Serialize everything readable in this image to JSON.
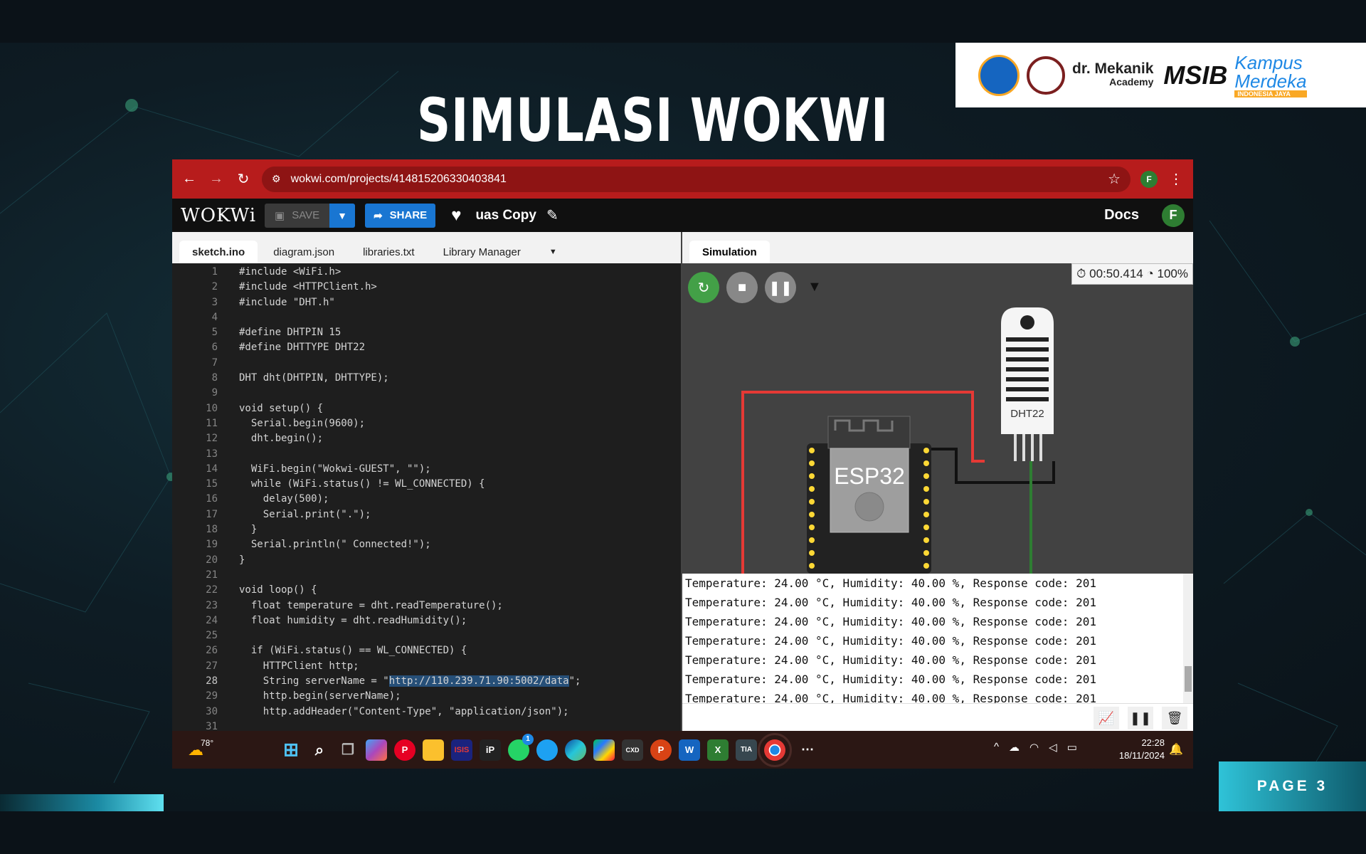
{
  "slide": {
    "title": "SIMULASI WOKWI",
    "page_label": "PAGE 3",
    "logos": {
      "org1": "dr. Mekanik",
      "org1_sub": "Academy",
      "org2": "MSIB",
      "org3": "Kampus",
      "org3b": "Merdeka",
      "org3_sub": "INDONESIA JAYA"
    }
  },
  "browser": {
    "url": "wokwi.com/projects/414815206330403841",
    "profile": "F"
  },
  "wokwi": {
    "logo": "WOKWi",
    "save_label": "SAVE",
    "share_label": "SHARE",
    "project_name": "uas Copy",
    "docs_label": "Docs",
    "user_initial": "F"
  },
  "editor": {
    "tabs": [
      "sketch.ino",
      "diagram.json",
      "libraries.txt",
      "Library Manager"
    ],
    "active_tab": "sketch.ino",
    "current_line": 28,
    "lines": [
      "#include <WiFi.h>",
      "#include <HTTPClient.h>",
      "#include \"DHT.h\"",
      "",
      "#define DHTPIN 15",
      "#define DHTTYPE DHT22",
      "",
      "DHT dht(DHTPIN, DHTTYPE);",
      "",
      "void setup() {",
      "  Serial.begin(9600);",
      "  dht.begin();",
      "",
      "  WiFi.begin(\"Wokwi-GUEST\", \"\");",
      "  while (WiFi.status() != WL_CONNECTED) {",
      "    delay(500);",
      "    Serial.print(\".\");",
      "  }",
      "  Serial.println(\" Connected!\");",
      "}",
      "",
      "void loop() {",
      "  float temperature = dht.readTemperature();",
      "  float humidity = dht.readHumidity();",
      "",
      "  if (WiFi.status() == WL_CONNECTED) {",
      "    HTTPClient http;",
      "    String serverName = \"http://110.239.71.90:5002/data\";",
      "    http.begin(serverName);",
      "    http.addHeader(\"Content-Type\", \"application/json\");",
      ""
    ],
    "selected_text": "http://110.239.71.90:5002/data"
  },
  "simulation": {
    "tab_label": "Simulation",
    "timer": "00:50.414",
    "speed": "100%",
    "board_label": "ESP32",
    "sensor_label": "DHT22",
    "serial_lines": [
      "Temperature: 24.00 °C, Humidity: 40.00 %, Response code: 201",
      "Temperature: 24.00 °C, Humidity: 40.00 %, Response code: 201",
      "Temperature: 24.00 °C, Humidity: 40.00 %, Response code: 201",
      "Temperature: 24.00 °C, Humidity: 40.00 %, Response code: 201",
      "Temperature: 24.00 °C, Humidity: 40.00 %, Response code: 201",
      "Temperature: 24.00 °C, Humidity: 40.00 %, Response code: 201",
      "Temperature: 24.00 °C, Humidity: 40.00 %, Response code: 201"
    ]
  },
  "taskbar": {
    "weather": "78°",
    "whatsapp_badge": "1",
    "time": "22:28",
    "date": "18/11/2024",
    "apps": [
      "windows-start",
      "search",
      "task-view",
      "copilot",
      "pinterest",
      "file-explorer",
      "isis",
      "ipi",
      "whatsapp",
      "twitter",
      "edge",
      "google-play",
      "cxd",
      "powerpoint",
      "word",
      "excel",
      "tia-v14",
      "chrome",
      "more"
    ]
  }
}
